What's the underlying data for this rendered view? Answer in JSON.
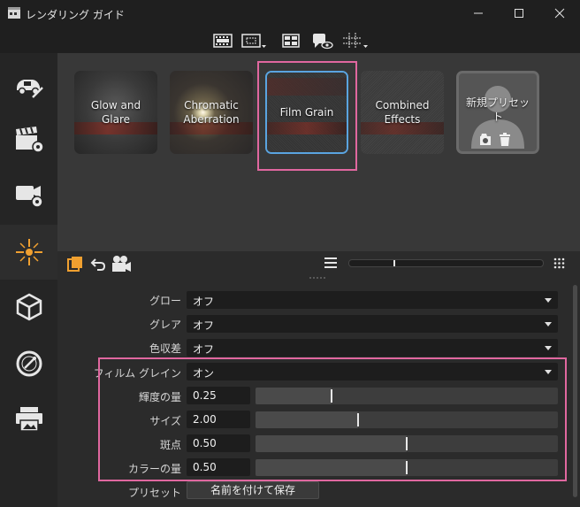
{
  "window": {
    "title": "レンダリング ガイド"
  },
  "presets": [
    {
      "label": "Glow and Glare"
    },
    {
      "label": "Chromatic Aberration"
    },
    {
      "label": "Film Grain"
    },
    {
      "label": "Combined Effects"
    },
    {
      "label": "新規プリセット"
    }
  ],
  "settings": {
    "glow": {
      "label": "グロー",
      "value": "オフ"
    },
    "glare": {
      "label": "グレア",
      "value": "オフ"
    },
    "chromatic": {
      "label": "色収差",
      "value": "オフ"
    },
    "film_grain": {
      "label": "フィルム グレイン",
      "value": "オン"
    },
    "luminance": {
      "label": "輝度の量",
      "value": "0.25",
      "fraction": 0.25
    },
    "size": {
      "label": "サイズ",
      "value": "2.00",
      "fraction": 0.34
    },
    "spots": {
      "label": "斑点",
      "value": "0.50",
      "fraction": 0.5
    },
    "color_amount": {
      "label": "カラーの量",
      "value": "0.50",
      "fraction": 0.5
    }
  },
  "preset_row": {
    "label": "プリセット",
    "save_button": "名前を付けて保存"
  },
  "colors": {
    "accent_orange": "#f0a030",
    "selection_blue": "#5aa4e0",
    "highlight_pink": "#e0679f"
  }
}
